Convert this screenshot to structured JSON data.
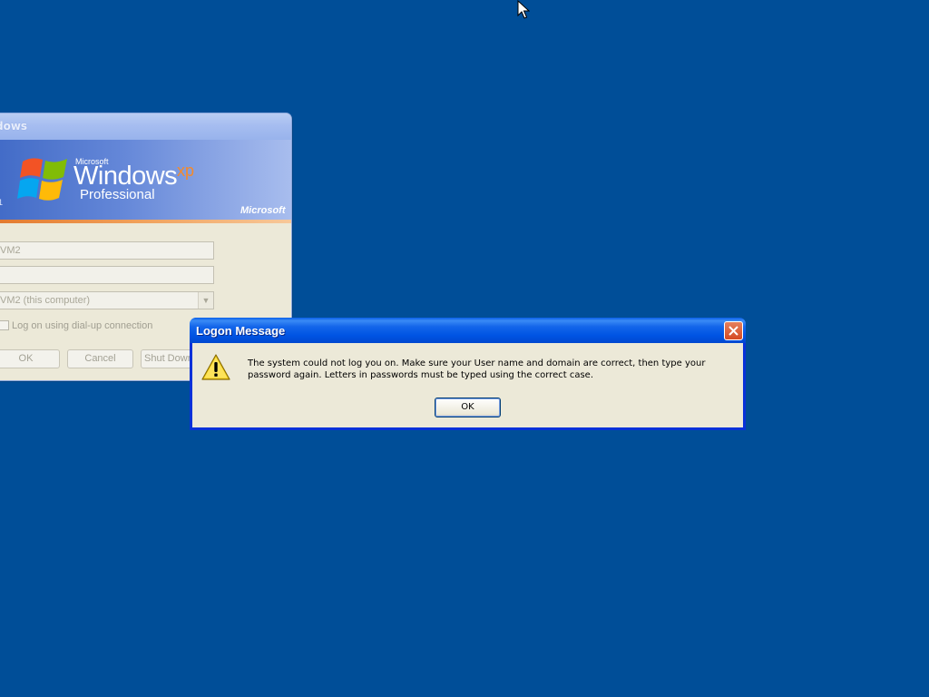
{
  "colors": {
    "desktop": "#004e98",
    "titlebar_active": "#0054e3",
    "dialog_face": "#ece9d8",
    "close_red": "#d54a22"
  },
  "logon_window": {
    "title": "dows",
    "banner": {
      "microsoft_small": "Microsoft",
      "windows_word": "Windows",
      "xp_word": "xp",
      "edition": "Professional",
      "brand": "Microsoft",
      "left_mark": "1"
    },
    "user_field_value": "VM2",
    "password_field_value": "",
    "domain_field_value": "VM2 (this computer)",
    "dialup_label": "Log on using dial-up connection",
    "ok_label": "OK",
    "cancel_label": "Cancel",
    "shutdown_label": "Shut Down"
  },
  "logon_message": {
    "title": "Logon Message",
    "text": "The system could not log you on.  Make sure your User name and domain are correct, then type your password again.  Letters in passwords must be typed using the correct case.",
    "ok_label": "OK",
    "icons": {
      "warning": "warning-icon",
      "close": "close-icon"
    }
  }
}
